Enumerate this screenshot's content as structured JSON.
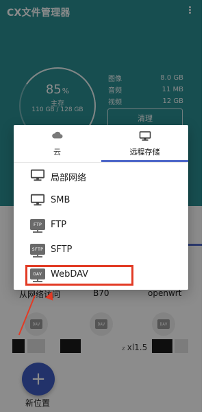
{
  "app": {
    "title": "CX文件管理器"
  },
  "storage": {
    "percent": "85",
    "percent_unit": "%",
    "label": "主存",
    "size": "110 GB / 128 GB",
    "stats": [
      {
        "label": "图像",
        "value": "8.0 GB"
      },
      {
        "label": "音频",
        "value": "11 MB"
      },
      {
        "label": "视频",
        "value": "12 GB"
      }
    ],
    "clean_label": "清理"
  },
  "dialog": {
    "tabs": [
      {
        "label": "云",
        "icon": "cloud-icon"
      },
      {
        "label": "远程存储",
        "icon": "monitor-icon"
      }
    ],
    "items": [
      {
        "label": "局部网络",
        "icon": "monitor-icon"
      },
      {
        "label": "SMB",
        "icon": "monitor-icon"
      },
      {
        "label": "FTP",
        "icon": "ftp-icon",
        "badge": "FTP"
      },
      {
        "label": "SFTP",
        "icon": "sftp-icon",
        "badge": "SFTP"
      },
      {
        "label": "WebDAV",
        "icon": "dav-icon",
        "badge": "DAV"
      }
    ]
  },
  "lower": {
    "device_labels": [
      "从网络访问",
      "B70",
      "openwrt"
    ],
    "dav_badges": [
      "DAV",
      "DAV",
      "DAV"
    ],
    "xl_prefix": "z",
    "xl_label": "xl1.5",
    "fab_label": "新位置",
    "fab_symbol": "+"
  },
  "colors": {
    "teal": "#2b8e93",
    "accent": "#4f68c9",
    "highlight_red": "#e23b25"
  }
}
